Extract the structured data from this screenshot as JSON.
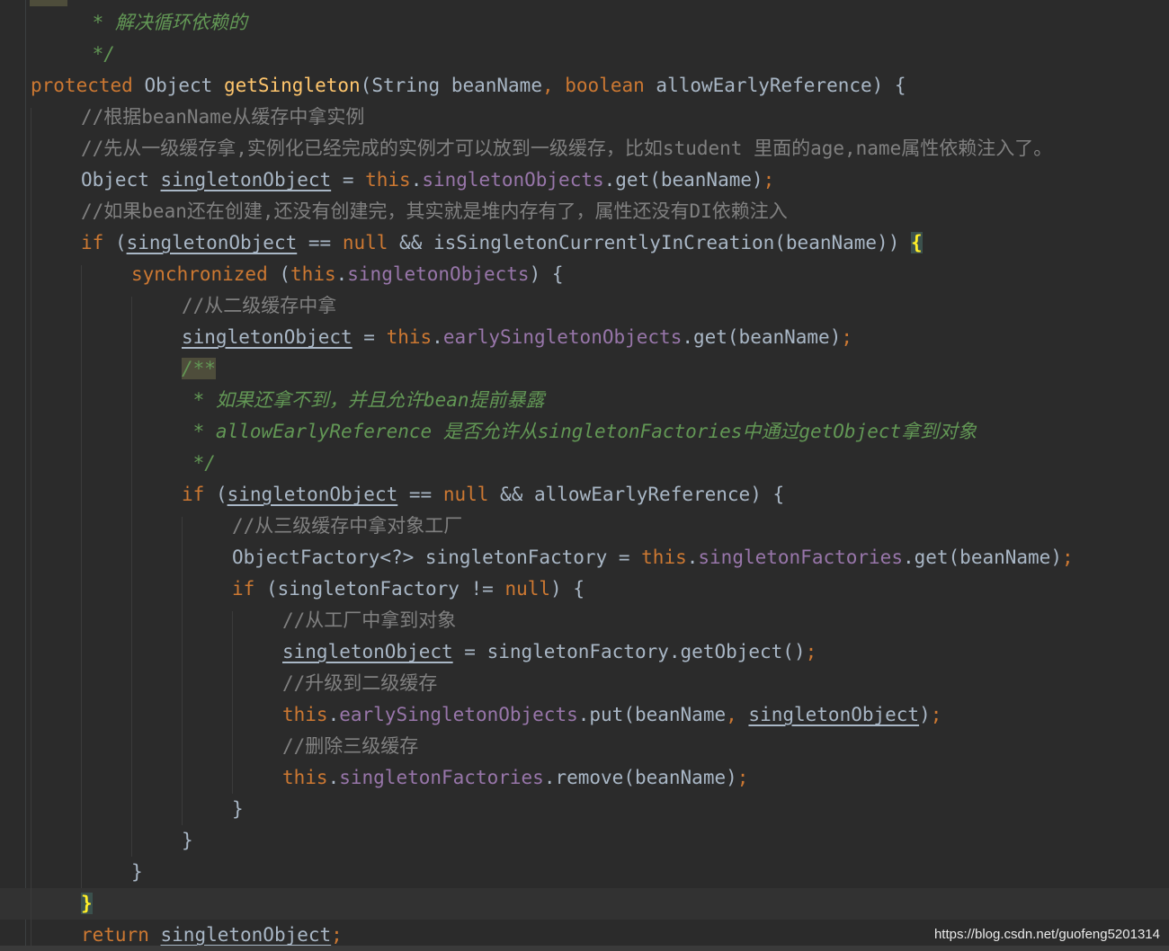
{
  "editor": {
    "lines": [
      {
        "indent": 1,
        "parts": [
          {
            "t": " * 解决循环依赖的",
            "c": "doc"
          }
        ]
      },
      {
        "indent": 1,
        "parts": [
          {
            "t": " */",
            "c": "doc"
          }
        ]
      },
      {
        "indent": 0,
        "parts": [
          {
            "t": "protected ",
            "c": "kw"
          },
          {
            "t": "Object ",
            "c": ""
          },
          {
            "t": "getSingleton",
            "c": "fn"
          },
          {
            "t": "(String beanName",
            "c": ""
          },
          {
            "t": ", ",
            "c": "kw"
          },
          {
            "t": "boolean ",
            "c": "kw"
          },
          {
            "t": "allowEarlyReference) {",
            "c": ""
          }
        ]
      },
      {
        "indent": 1,
        "parts": [
          {
            "t": "//根据beanName从缓存中拿实例",
            "c": "cm"
          }
        ]
      },
      {
        "indent": 1,
        "parts": [
          {
            "t": "//先从一级缓存拿,实例化已经完成的实例才可以放到一级缓存，比如student 里面的age,name属性依赖注入了。",
            "c": "cm"
          }
        ]
      },
      {
        "indent": 1,
        "parts": [
          {
            "t": "Object ",
            "c": ""
          },
          {
            "t": "singletonObject",
            "c": "ul"
          },
          {
            "t": " = ",
            "c": ""
          },
          {
            "t": "this",
            "c": "kw"
          },
          {
            "t": ".",
            "c": ""
          },
          {
            "t": "singletonObjects",
            "c": "fld"
          },
          {
            "t": ".get(beanName)",
            "c": ""
          },
          {
            "t": ";",
            "c": "kw"
          }
        ]
      },
      {
        "indent": 1,
        "parts": [
          {
            "t": "//如果bean还在创建,还没有创建完，其实就是堆内存有了，属性还没有DI依赖注入",
            "c": "cm"
          }
        ]
      },
      {
        "indent": 1,
        "parts": [
          {
            "t": "if ",
            "c": "kw"
          },
          {
            "t": "(",
            "c": ""
          },
          {
            "t": "singletonObject",
            "c": "ul"
          },
          {
            "t": " == ",
            "c": ""
          },
          {
            "t": "null ",
            "c": "kw"
          },
          {
            "t": "&& isSingletonCurrentlyInCreation(beanName)) ",
            "c": ""
          },
          {
            "t": "{",
            "c": "brace-hl"
          }
        ]
      },
      {
        "indent": 2,
        "parts": [
          {
            "t": "synchronized ",
            "c": "kw"
          },
          {
            "t": "(",
            "c": ""
          },
          {
            "t": "this",
            "c": "kw"
          },
          {
            "t": ".",
            "c": ""
          },
          {
            "t": "singletonObjects",
            "c": "fld"
          },
          {
            "t": ") {",
            "c": ""
          }
        ]
      },
      {
        "indent": 3,
        "parts": [
          {
            "t": "//从二级缓存中拿",
            "c": "cm"
          }
        ]
      },
      {
        "indent": 3,
        "parts": [
          {
            "t": "singletonObject",
            "c": "ul"
          },
          {
            "t": " = ",
            "c": ""
          },
          {
            "t": "this",
            "c": "kw"
          },
          {
            "t": ".",
            "c": ""
          },
          {
            "t": "earlySingletonObjects",
            "c": "fld"
          },
          {
            "t": ".get(beanName)",
            "c": ""
          },
          {
            "t": ";",
            "c": "kw"
          }
        ]
      },
      {
        "indent": 3,
        "parts": [
          {
            "t": "/**",
            "c": "doc doc-open"
          }
        ]
      },
      {
        "indent": 3,
        "parts": [
          {
            "t": " * 如果还拿不到，并且允许bean提前暴露",
            "c": "doc"
          }
        ]
      },
      {
        "indent": 3,
        "parts": [
          {
            "t": " * allowEarlyReference 是否允许从singletonFactories中通过getObject拿到对象",
            "c": "doc"
          }
        ]
      },
      {
        "indent": 3,
        "parts": [
          {
            "t": " */",
            "c": "doc"
          }
        ]
      },
      {
        "indent": 3,
        "parts": [
          {
            "t": "if ",
            "c": "kw"
          },
          {
            "t": "(",
            "c": ""
          },
          {
            "t": "singletonObject",
            "c": "ul"
          },
          {
            "t": " == ",
            "c": ""
          },
          {
            "t": "null ",
            "c": "kw"
          },
          {
            "t": "&& allowEarlyReference) {",
            "c": ""
          }
        ]
      },
      {
        "indent": 4,
        "parts": [
          {
            "t": "//从三级缓存中拿对象工厂",
            "c": "cm"
          }
        ]
      },
      {
        "indent": 4,
        "parts": [
          {
            "t": "ObjectFactory<?> singletonFactory = ",
            "c": ""
          },
          {
            "t": "this",
            "c": "kw"
          },
          {
            "t": ".",
            "c": ""
          },
          {
            "t": "singletonFactories",
            "c": "fld"
          },
          {
            "t": ".get(beanName)",
            "c": ""
          },
          {
            "t": ";",
            "c": "kw"
          }
        ]
      },
      {
        "indent": 4,
        "parts": [
          {
            "t": "if ",
            "c": "kw"
          },
          {
            "t": "(singletonFactory != ",
            "c": ""
          },
          {
            "t": "null",
            "c": "kw"
          },
          {
            "t": ") {",
            "c": ""
          }
        ]
      },
      {
        "indent": 5,
        "parts": [
          {
            "t": "//从工厂中拿到对象",
            "c": "cm"
          }
        ]
      },
      {
        "indent": 5,
        "parts": [
          {
            "t": "singletonObject",
            "c": "ul"
          },
          {
            "t": " = singletonFactory.getObject()",
            "c": ""
          },
          {
            "t": ";",
            "c": "kw"
          }
        ]
      },
      {
        "indent": 5,
        "parts": [
          {
            "t": "//升级到二级缓存",
            "c": "cm"
          }
        ]
      },
      {
        "indent": 5,
        "parts": [
          {
            "t": "this",
            "c": "kw"
          },
          {
            "t": ".",
            "c": ""
          },
          {
            "t": "earlySingletonObjects",
            "c": "fld"
          },
          {
            "t": ".put(beanName",
            "c": ""
          },
          {
            "t": ", ",
            "c": "kw"
          },
          {
            "t": "singletonObject",
            "c": "ul"
          },
          {
            "t": ")",
            "c": ""
          },
          {
            "t": ";",
            "c": "kw"
          }
        ]
      },
      {
        "indent": 5,
        "parts": [
          {
            "t": "//删除三级缓存",
            "c": "cm"
          }
        ]
      },
      {
        "indent": 5,
        "parts": [
          {
            "t": "this",
            "c": "kw"
          },
          {
            "t": ".",
            "c": ""
          },
          {
            "t": "singletonFactories",
            "c": "fld"
          },
          {
            "t": ".remove(beanName)",
            "c": ""
          },
          {
            "t": ";",
            "c": "kw"
          }
        ]
      },
      {
        "indent": 4,
        "parts": [
          {
            "t": "}",
            "c": ""
          }
        ]
      },
      {
        "indent": 3,
        "parts": [
          {
            "t": "}",
            "c": ""
          }
        ]
      },
      {
        "indent": 2,
        "parts": [
          {
            "t": "}",
            "c": ""
          }
        ]
      },
      {
        "indent": 1,
        "parts": [
          {
            "t": "}",
            "c": "brace-hl"
          }
        ]
      },
      {
        "indent": 1,
        "parts": [
          {
            "t": "return ",
            "c": "kw"
          },
          {
            "t": "singletonObject",
            "c": "ul"
          },
          {
            "t": ";",
            "c": "kw"
          }
        ]
      }
    ]
  },
  "watermark": "https://blog.csdn.net/guofeng5201314",
  "colors": {
    "background": "#2b2b2b",
    "keyword": "#cc7832",
    "method": "#ffc66d",
    "field": "#9876aa",
    "comment": "#808080",
    "doc_comment": "#629755",
    "text": "#a9b7c6"
  }
}
